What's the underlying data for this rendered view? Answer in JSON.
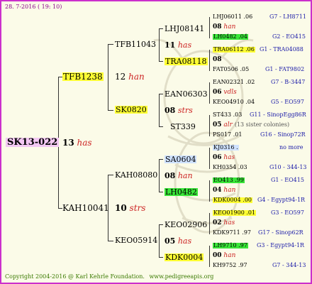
{
  "header": {
    "date": "28. 7-2016 ( 19: 10)"
  },
  "subject": {
    "name": "SK13-022"
  },
  "gen1": {
    "top": {
      "name": "TFB1238",
      "num": "13",
      "race": "has"
    },
    "bottom": {
      "name": "KAH10041",
      "num": "10",
      "race": "strs"
    }
  },
  "gen2": [
    {
      "name": "TFB11043",
      "num": "11",
      "race": "has"
    },
    {
      "name": "SK0820",
      "num": "12",
      "race": "han"
    },
    {
      "name": "KAH08080",
      "num": "08",
      "race": "han"
    },
    {
      "name": "KEO05914",
      "num": "10",
      "race": "strs"
    }
  ],
  "gen3": [
    {
      "name": "LHJ08141",
      "num": "08",
      "race": "has"
    },
    {
      "name": "TRA08118",
      "num": "08",
      "race": ""
    },
    {
      "name": "EAN06303",
      "num": "08",
      "race": "strs"
    },
    {
      "name": "ST339",
      "num": "05",
      "race": "alr"
    },
    {
      "name": "SA0604",
      "num": "06",
      "race": "has"
    },
    {
      "name": "LH0482",
      "num": "04",
      "race": "han"
    },
    {
      "name": "KEO02906",
      "num": "02",
      "race": "has"
    },
    {
      "name": "KDK0004",
      "num": "00",
      "race": "han"
    }
  ],
  "gen3_side": [
    {
      "num": "11",
      "race": "has"
    },
    {
      "num": "12",
      "race": "han"
    },
    {
      "num": "08",
      "race": "strs"
    },
    {
      "num": "",
      "race": ""
    },
    {
      "num": "08",
      "race": "han"
    },
    {
      "num": "10",
      "race": "strs"
    },
    {
      "num": "05",
      "race": "has"
    },
    {
      "num": "",
      "race": ""
    }
  ],
  "gen4": [
    {
      "top": {
        "name": "LHJ06011",
        "year": ".06",
        "ref": "G7 - LH8711"
      },
      "num": "08",
      "race": "han",
      "bottom": {
        "name": "LH0482",
        "year": ".04",
        "ref": "G2 - EO415"
      }
    },
    {
      "top": {
        "name": "TRA06112",
        "year": ".06",
        "ref": "G1 - TRA04088"
      },
      "num": "08",
      "race": "",
      "bottom": {
        "name": "FAT0506",
        "year": ".05",
        "ref": "G1 - FAT9802"
      }
    },
    {
      "top": {
        "name": "EAN02321",
        "year": ".02",
        "ref": "G7 - B-3447"
      },
      "num": "06",
      "race": "vdls",
      "bottom": {
        "name": "KEO04910",
        "year": ".04",
        "ref": "G5 - EO597"
      }
    },
    {
      "top": {
        "name": "ST433",
        "year": ".03",
        "ref": "G11 - SinopEgg86R"
      },
      "num": "05",
      "race": "alr",
      "note": "(13 sister colonies)",
      "bottom": {
        "name": "PS017",
        "year": ".01",
        "ref": "G16 - Sinop72R"
      }
    },
    {
      "top": {
        "name": "KJ0316",
        "year": ".",
        "ref": "no more"
      },
      "num": "06",
      "race": "has",
      "bottom": {
        "name": "KH0354",
        "year": ".03",
        "ref": "G10 - 344-13"
      }
    },
    {
      "top": {
        "name": "EO413",
        "year": ".99",
        "ref": "G1 - EO415"
      },
      "num": "04",
      "race": "han",
      "bottom": {
        "name": "KDK0004",
        "year": ".00",
        "ref": "G4 - Egypt94-1R"
      }
    },
    {
      "top": {
        "name": "KEO01900",
        "year": ".01",
        "ref": "G3 - EO597"
      },
      "num": "02",
      "race": "has",
      "bottom": {
        "name": "KDK9711",
        "year": ".97",
        "ref": "G17 - Sinop62R"
      }
    },
    {
      "top": {
        "name": "LH9710",
        "year": ".97",
        "ref": "G3 - Egypt94-1R"
      },
      "num": "00",
      "race": "han",
      "bottom": {
        "name": "KH9752",
        "year": ".97",
        "ref": "G7 - 344-13"
      }
    }
  ],
  "footer": {
    "copyright": "Copyright 2004-2016 @ Karl Kehrle Foundation.",
    "site": "www.pedigreeapis.org"
  }
}
